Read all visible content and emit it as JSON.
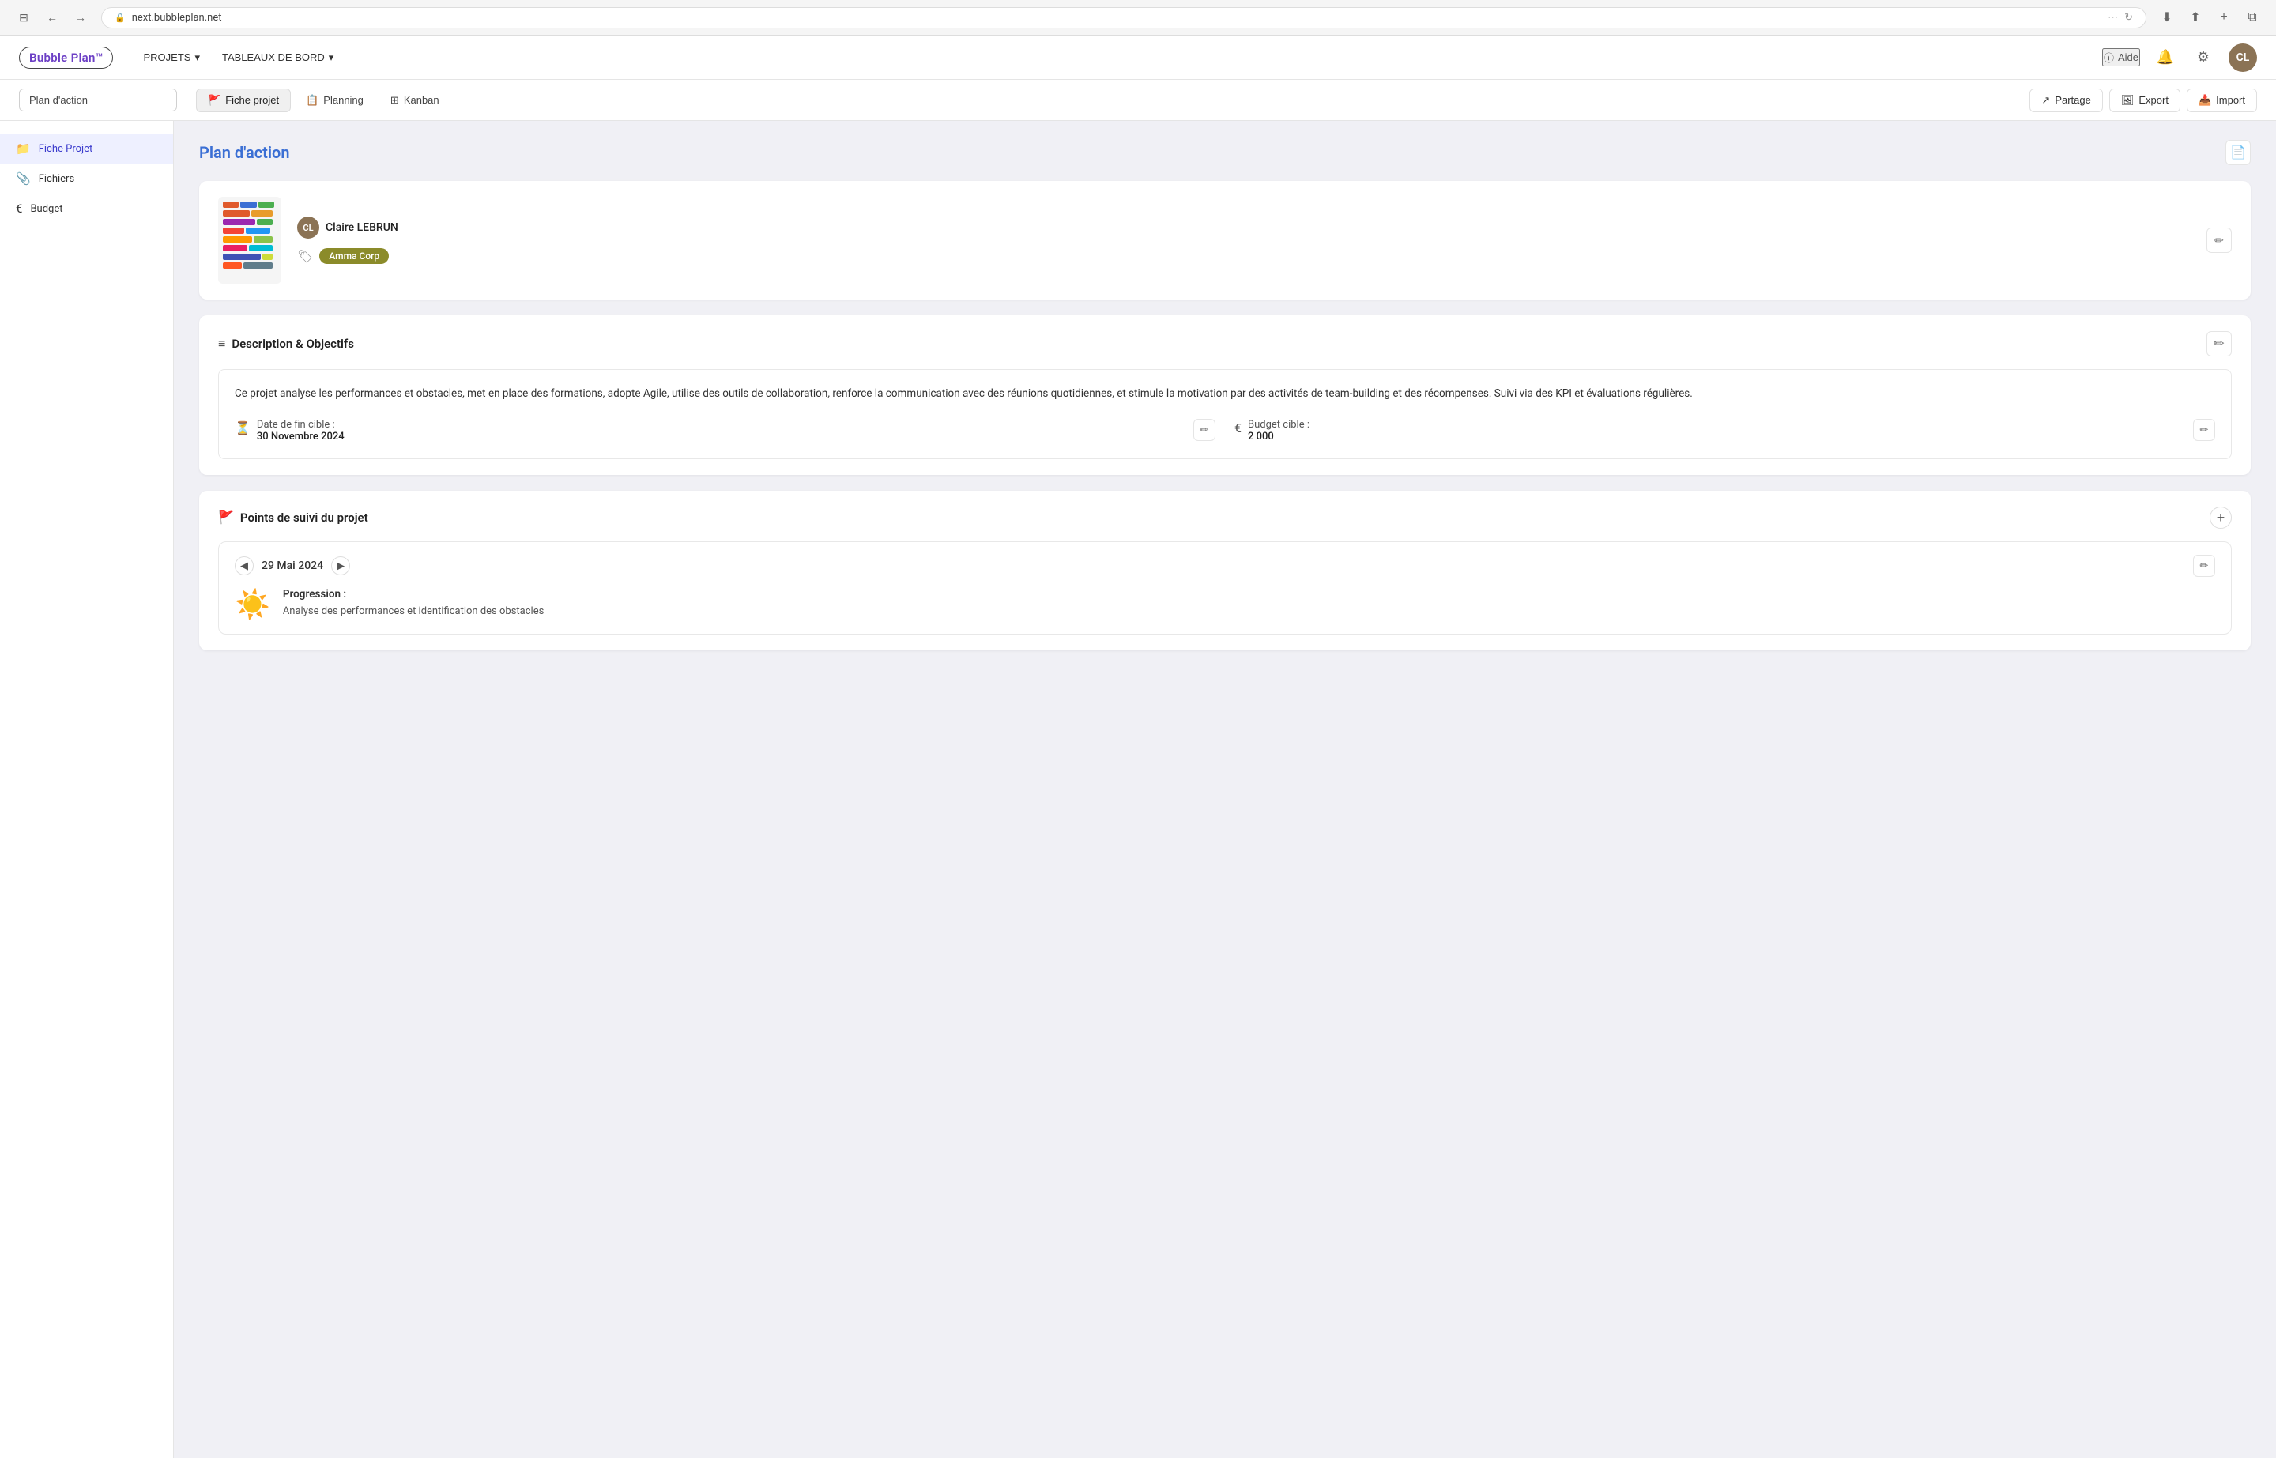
{
  "browser": {
    "url": "next.bubbleplan.net",
    "back_btn": "←",
    "forward_btn": "→",
    "window_controls": "⊟"
  },
  "header": {
    "logo": "Bubble Plan",
    "nav": [
      {
        "label": "PROJETS",
        "has_dropdown": true
      },
      {
        "label": "TABLEAUX DE BORD",
        "has_dropdown": true
      }
    ],
    "help_label": "Aide",
    "notification_icon": "🔔",
    "settings_icon": "⚙"
  },
  "second_toolbar": {
    "search_placeholder": "Plan d'action",
    "tabs": [
      {
        "label": "Fiche projet",
        "icon": "🚩",
        "active": true
      },
      {
        "label": "Planning",
        "icon": "📋",
        "active": false
      },
      {
        "label": "Kanban",
        "icon": "⊞",
        "active": false
      }
    ],
    "actions": [
      {
        "label": "Partage",
        "icon": "↗"
      },
      {
        "label": "Export",
        "icon": "⬛"
      },
      {
        "label": "Import",
        "icon": "⬛"
      }
    ]
  },
  "sidebar": {
    "items": [
      {
        "label": "Fiche Projet",
        "icon": "📁",
        "active": true
      },
      {
        "label": "Fichiers",
        "icon": "📎",
        "active": false
      },
      {
        "label": "Budget",
        "icon": "€",
        "active": false
      }
    ]
  },
  "project": {
    "title": "Plan d'action",
    "owner": "Claire LEBRUN",
    "tag": "Amma Corp",
    "thumbnail_alt": "Project planning chart",
    "description_section": {
      "title": "Description & Objectifs",
      "text": "Ce projet analyse les performances et obstacles, met en place des formations, adopte Agile, utilise des outils de collaboration, renforce la communication avec des réunions quotidiennes, et stimule la motivation par des activités de team-building et des récompenses. Suivi via des KPI et évaluations régulières.",
      "date_label": "Date de fin cible :",
      "date_value": "30 Novembre 2024",
      "budget_label": "Budget cible :",
      "budget_value": "2 000"
    },
    "suivi_section": {
      "title": "Points de suivi du projet",
      "entry": {
        "date": "29 Mai 2024",
        "emoji": "☀️",
        "progression_label": "Progression :",
        "progression_text": "Analyse des performances et identification des obstacles"
      }
    }
  }
}
